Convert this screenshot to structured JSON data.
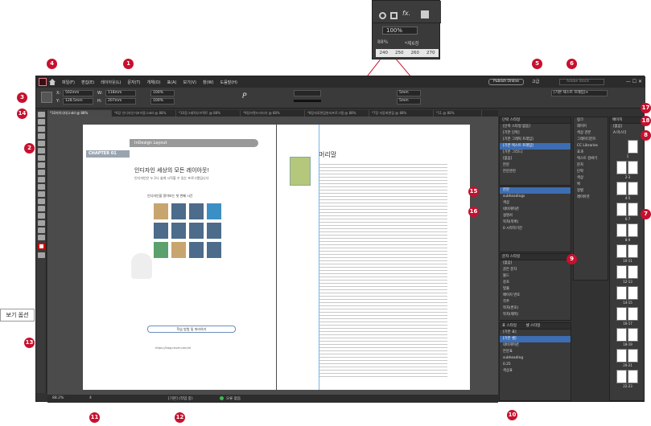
{
  "menu": {
    "items": [
      "파일(F)",
      "편집(E)",
      "레이아웃(L)",
      "문자(T)",
      "개체(O)",
      "표(A)",
      "보기(V)",
      "창(W)",
      "도움말(H)"
    ],
    "publish": "Publish Online",
    "workspace": "고급",
    "search_placeholder": "Adobe Stock"
  },
  "control": {
    "x": "502mm",
    "y": "128.5mm",
    "w": "118mm",
    "h": "207mm",
    "zoom": "100%",
    "style_label": "[기본 텍스트 프레임]+",
    "stroke_size": "5mm",
    "percent": "100%"
  },
  "zoom_inset": {
    "zoom": "100%",
    "pct": "88%",
    "tab_fragment": "*제6장",
    "ruler": [
      "240",
      "250",
      "260",
      "270"
    ]
  },
  "tabs": [
    "*10자이너대.indd @ 88%",
    "*6장 인디자인기초이용.indd @ 88%",
    "*10장그래픽오브젝트 @ 88%",
    "*9장브랜드리티카 @ 88%",
    "*8장자료편집완리프로그램 @ 88%",
    "*7장 자동화편집 @ 88%",
    "*11 @ 88%"
  ],
  "document": {
    "chapter": "CHAPTER 01",
    "header_box": "InDesign Layout",
    "title": "인디자인 세상의 모든 레이아웃!",
    "subtitle": "인디자인은 누구나 쉽게 시작할 수 있는 프로그램입니다",
    "section_label": "인디자인을 알아보는 첫 번째 시간",
    "right_heading": "머리말",
    "footer_box": "학습 방법 및 따라하기",
    "link_text": "https://blog.naver.com/id"
  },
  "status": {
    "zoom": "88.2%",
    "page": "4",
    "style": "[기본] (작업 중)",
    "errors": "오류 없음"
  },
  "panels": {
    "para": {
      "title": "단락 스타일",
      "items": [
        "[단락 스타일 없음]",
        "[기본 단락]",
        "[기본 그래픽 프레임]",
        "[기본 텍스트 프레임]",
        "[기본 그리드]",
        "[없음]",
        "본문",
        "본문관련"
      ]
    },
    "pages_list": {
      "items": [
        "본문",
        "subheadings",
        "색상",
        "네비게이션",
        "설명서",
        "목차(목록)",
        "0 시작하기전"
      ]
    },
    "char": {
      "title": "문자 스타일",
      "items": [
        "[없음]",
        "굵은 문자",
        "볼드",
        "강조",
        "밑줄",
        "페이지 번호",
        "각주",
        "목차(번호)",
        "목차(제목)"
      ]
    },
    "obj": {
      "tabs": [
        "표 스타일",
        "셀 스타일"
      ],
      "items": [
        "[기본 표]",
        "[기본 셀]",
        "네비게이션",
        "본문표",
        "subheading",
        "0.25",
        "색상표"
      ]
    },
    "dock": {
      "items": [
        "링크",
        "레이어",
        "색상 견본",
        "그레이디언트",
        "CC Libraries",
        "효과",
        "텍스트 감싸기",
        "문자",
        "단락",
        "색상",
        "획",
        "정렬",
        "레이아웃"
      ]
    },
    "pages": {
      "title": "페이지",
      "master": "[없음]",
      "master2": "A-마스터",
      "labels": [
        "1",
        "2-3",
        "4-5",
        "6-7",
        "8-9",
        "10-11",
        "12-13",
        "14-15",
        "16-17",
        "18-19",
        "20-21",
        "22-23"
      ]
    }
  },
  "callouts": {
    "n1": "1",
    "n2": "2",
    "n3": "3",
    "n4": "4",
    "n5": "5",
    "n6": "6",
    "n7": "7",
    "n8": "8",
    "n9": "9",
    "n10": "10",
    "n11": "11",
    "n12": "12",
    "n13": "13",
    "n14": "14",
    "n15": "15",
    "n16": "16",
    "n17": "17",
    "n18": "18"
  },
  "view_options_label": "보기 옵션",
  "colors": {
    "callout": "#c8102e",
    "ui_dark": "#323232",
    "selection": "#3d6db3"
  }
}
